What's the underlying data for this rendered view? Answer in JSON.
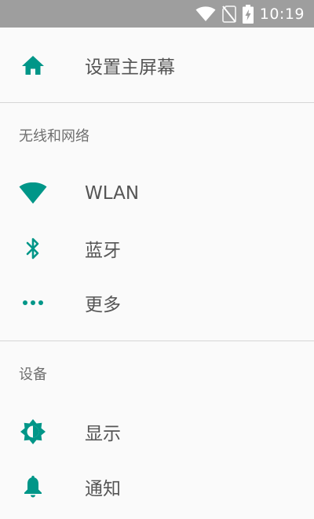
{
  "status_bar": {
    "time": "10:19",
    "icons": [
      "wifi-icon",
      "no-sim-icon",
      "battery-charging-icon"
    ]
  },
  "colors": {
    "accent": "#009688",
    "status_bar_bg": "#9e9e9e",
    "text_primary": "#555555",
    "section_header": "#6f6f6f",
    "divider": "#d6d6d6",
    "background": "#fafafa"
  },
  "top_item": {
    "label": "设置主屏幕",
    "icon": "home-icon"
  },
  "sections": [
    {
      "title": "无线和网络",
      "items": [
        {
          "label": "WLAN",
          "icon": "wifi-icon"
        },
        {
          "label": "蓝牙",
          "icon": "bluetooth-icon"
        },
        {
          "label": "更多",
          "icon": "more-icon"
        }
      ]
    },
    {
      "title": "设备",
      "items": [
        {
          "label": "显示",
          "icon": "brightness-icon"
        },
        {
          "label": "通知",
          "icon": "bell-icon"
        }
      ]
    }
  ]
}
